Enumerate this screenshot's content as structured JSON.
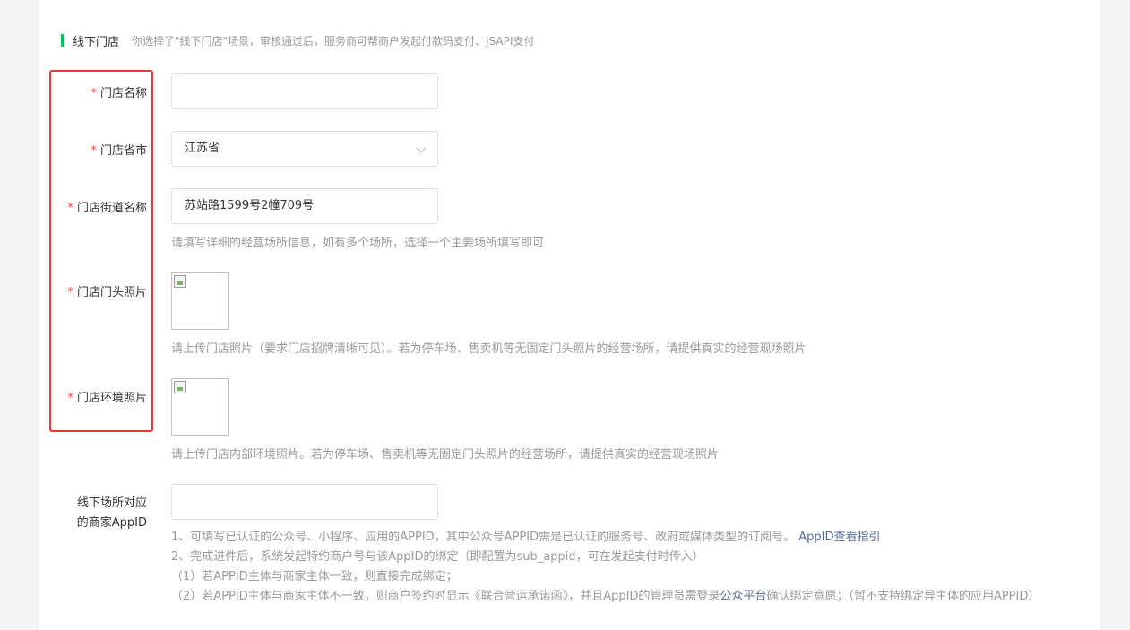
{
  "section": {
    "title": "线下门店",
    "description": "你选择了\"线下门店\"场景，审核通过后，服务商可帮商户发起付款码支付、JSAPI支付",
    "accent_color": "#07c160"
  },
  "fields": {
    "store_name": {
      "required_mark": "*",
      "label": "门店名称",
      "value": ""
    },
    "store_province": {
      "required_mark": "*",
      "label": "门店省市",
      "value": "江苏省",
      "icon": "chevron-down-icon"
    },
    "store_street": {
      "required_mark": "*",
      "label": "门店街道名称",
      "value": "苏站路1599号2幢709号",
      "hint": "请填写详细的经营场所信息，如有多个场所，选择一个主要场所填写即可"
    },
    "store_front_photo": {
      "required_mark": "*",
      "label": "门店门头照片",
      "hint": "请上传门店照片（要求门店招牌清晰可见）。若为停车场、售卖机等无固定门头照片的经营场所，请提供真实的经营现场照片",
      "icon": "broken-image-icon"
    },
    "store_env_photo": {
      "required_mark": "*",
      "label": "门店环境照片",
      "hint": "请上传门店内部环境照片。若为停车场、售卖机等无固定门头照片的经营场所，请提供真实的经营现场照片",
      "icon": "broken-image-icon"
    },
    "appid": {
      "label_line1": "线下场所对应",
      "label_line2": "的商家AppID",
      "value": "",
      "note1": "1、可填写已认证的公众号、小程序、应用的APPID，其中公众号APPID需是已认证的服务号、政府或媒体类型的订阅号。",
      "note1_link": "AppID查看指引",
      "note2": "2、完成进件后，系统发起特约商户号与该AppID的绑定（即配置为sub_appid，可在发起支付时传入）",
      "note3": "（1）若APPID主体与商家主体一致，则直接完成绑定；",
      "note4_a": "（2）若APPID主体与商家主体不一致，则商户签约时显示《联合营运承诺函》，并且AppID的管理员需登录",
      "note4_link": "公众平台",
      "note4_b": "确认绑定意愿；（暂不支持绑定异主体的应用APPID）"
    }
  },
  "colors": {
    "required": "#e64340",
    "link": "#576b95",
    "highlight": "#e53935"
  }
}
